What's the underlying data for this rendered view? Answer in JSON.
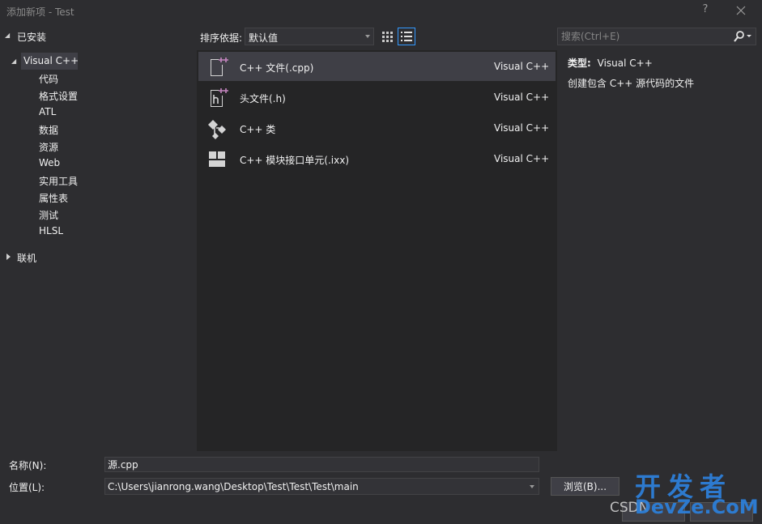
{
  "window": {
    "title": "添加新项 - Test",
    "help_label": "?"
  },
  "tree": {
    "installed_label": "已安装",
    "root": {
      "label": "Visual C++",
      "children": [
        "代码",
        "格式设置",
        "ATL",
        "数据",
        "资源",
        "Web",
        "实用工具",
        "属性表",
        "测试",
        "HLSL"
      ]
    },
    "online_label": "联机"
  },
  "toolbar": {
    "sort_label": "排序依据:",
    "sort_value": "默认值"
  },
  "search": {
    "placeholder": "搜索(Ctrl+E)"
  },
  "templates": [
    {
      "name": "C++ 文件(.cpp)",
      "language": "Visual C++",
      "icon": "cpp-file-icon",
      "selected": true
    },
    {
      "name": "头文件(.h)",
      "language": "Visual C++",
      "icon": "header-file-icon",
      "selected": false
    },
    {
      "name": "C++ 类",
      "language": "Visual C++",
      "icon": "cpp-class-icon",
      "selected": false
    },
    {
      "name": "C++ 模块接口单元(.ixx)",
      "language": "Visual C++",
      "icon": "module-interface-icon",
      "selected": false
    }
  ],
  "details": {
    "type_label": "类型:",
    "type_value": "Visual C++",
    "description": "创建包含 C++ 源代码的文件"
  },
  "form": {
    "name_label": "名称(N):",
    "name_value": "源.cpp",
    "location_label": "位置(L):",
    "location_value": "C:\\Users\\jianrong.wang\\Desktop\\Test\\Test\\Test\\main",
    "browse_label": "浏览(B)..."
  },
  "watermark": {
    "line1": "开发者",
    "csdn": "CSDN",
    "line2": "DevZe.CoM"
  },
  "colors": {
    "background": "#2d2d30",
    "list_background": "#252526",
    "selection": "#3f3f46",
    "accent": "#3399ff",
    "icon_purple": "#c586c0",
    "watermark_blue": "#2d7fd8"
  }
}
